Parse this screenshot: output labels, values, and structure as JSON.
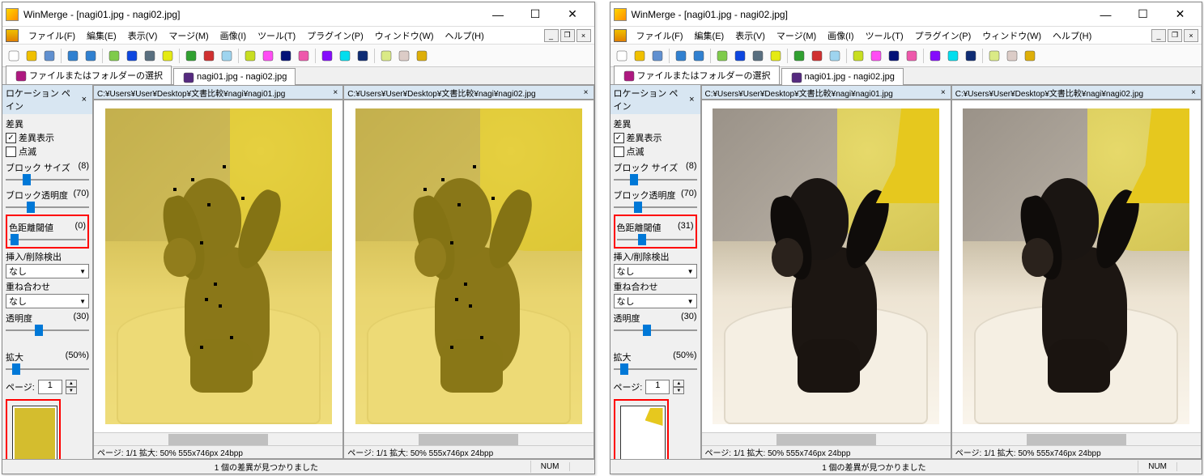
{
  "windows": [
    {
      "title": "WinMerge - [nagi01.jpg - nagi02.jpg]",
      "menu": [
        "ファイル(F)",
        "編集(E)",
        "表示(V)",
        "マージ(M)",
        "画像(I)",
        "ツール(T)",
        "プラグイン(P)",
        "ウィンドウ(W)",
        "ヘルプ(H)"
      ],
      "tabs": [
        {
          "label": "ファイルまたはフォルダーの選択",
          "icon": "folder"
        },
        {
          "label": "nagi01.jpg - nagi02.jpg",
          "icon": "img",
          "active": true
        }
      ],
      "sidebar": {
        "header": "ロケーション ペイン",
        "sec_diff": "差異",
        "chk_show": "差異表示",
        "chk_show_v": true,
        "chk_blink": "点滅",
        "chk_blink_v": false,
        "lbl_blocksize": "ブロック サイズ",
        "val_blocksize": "(8)",
        "slider_blocksize": 20,
        "lbl_blockalpha": "ブロック透明度",
        "val_blockalpha": "(70)",
        "slider_blockalpha": 25,
        "lbl_colordist": "色距離閾値",
        "val_colordist": "(0)",
        "slider_colordist": 2,
        "lbl_insdet": "挿入/削除検出",
        "sel_insdet": "なし",
        "lbl_overlay": "重ね合わせ",
        "sel_overlay": "なし",
        "lbl_alpha": "透明度",
        "val_alpha": "(30)",
        "slider_alpha": 35,
        "lbl_zoom": "拡大",
        "val_zoom": "(50%)",
        "slider_zoom": 8,
        "lbl_page": "ページ:",
        "val_page": "1",
        "thumb_style": "full-yellow"
      },
      "paths": [
        "C:¥Users¥User¥Desktop¥文書比較¥nagi¥nagi01.jpg",
        "C:¥Users¥User¥Desktop¥文書比較¥nagi¥nagi02.jpg"
      ],
      "img_info": "ページ: 1/1  拡大: 50%  555x746px  24bpp",
      "overlay_mode": "full",
      "status": {
        "msg": "1 個の差異が見つかりました",
        "num": "NUM"
      }
    },
    {
      "title": "WinMerge - [nagi01.jpg - nagi02.jpg]",
      "menu": [
        "ファイル(F)",
        "編集(E)",
        "表示(V)",
        "マージ(M)",
        "画像(I)",
        "ツール(T)",
        "プラグイン(P)",
        "ウィンドウ(W)",
        "ヘルプ(H)"
      ],
      "tabs": [
        {
          "label": "ファイルまたはフォルダーの選択",
          "icon": "folder"
        },
        {
          "label": "nagi01.jpg - nagi02.jpg",
          "icon": "img",
          "active": true
        }
      ],
      "sidebar": {
        "header": "ロケーション ペイン",
        "sec_diff": "差異",
        "chk_show": "差異表示",
        "chk_show_v": true,
        "chk_blink": "点滅",
        "chk_blink_v": false,
        "lbl_blocksize": "ブロック サイズ",
        "val_blocksize": "(8)",
        "slider_blocksize": 20,
        "lbl_blockalpha": "ブロック透明度",
        "val_blockalpha": "(70)",
        "slider_blockalpha": 25,
        "lbl_colordist": "色距離閾値",
        "val_colordist": "(31)",
        "slider_colordist": 28,
        "lbl_insdet": "挿入/削除検出",
        "sel_insdet": "なし",
        "lbl_overlay": "重ね合わせ",
        "sel_overlay": "なし",
        "lbl_alpha": "透明度",
        "val_alpha": "(30)",
        "slider_alpha": 35,
        "lbl_zoom": "拡大",
        "val_zoom": "(50%)",
        "slider_zoom": 8,
        "lbl_page": "ページ:",
        "val_page": "1",
        "thumb_style": "corner-yellow"
      },
      "paths": [
        "C:¥Users¥User¥Desktop¥文書比較¥nagi¥nagi01.jpg",
        "C:¥Users¥User¥Desktop¥文書比較¥nagi¥nagi02.jpg"
      ],
      "img_info": "ページ: 1/1  拡大: 50%  555x746px  24bpp",
      "overlay_mode": "corner",
      "status": {
        "msg": "1 個の差異が見つかりました",
        "num": "NUM"
      }
    }
  ],
  "toolbar_icons": [
    "new",
    "open",
    "save",
    "",
    "undo",
    "redo",
    "",
    "diff-up-left",
    "diff-down-left",
    "diff-up-right",
    "diff-down-right",
    "",
    "refresh",
    "stop",
    "view1",
    "",
    "nav-first",
    "nav-prev",
    "nav-next",
    "nav-last",
    "",
    "merge-all",
    "merge-l",
    "merge-r",
    "",
    "opt1",
    "opt2",
    "opt3"
  ]
}
